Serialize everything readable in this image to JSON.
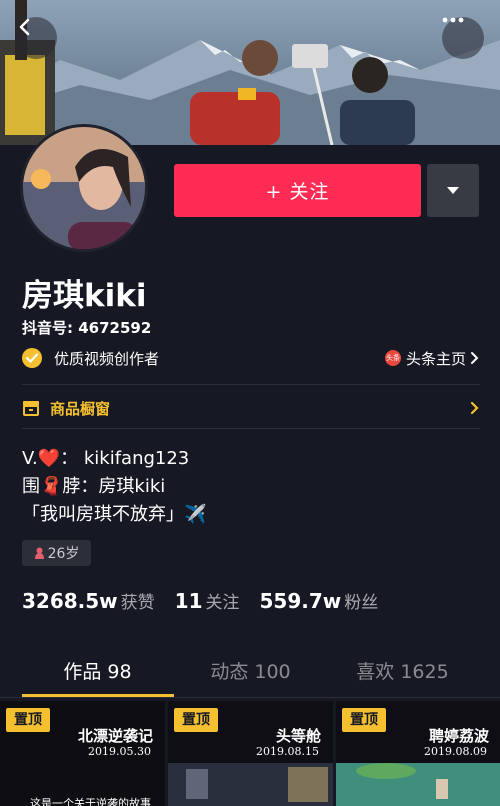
{
  "header": {
    "back_icon": "chevron-left-icon",
    "more_icon": "more-horizontal-icon"
  },
  "profile": {
    "follow_label": "+ 关注",
    "nickname": "房琪kiki",
    "douyin_id": "抖音号: 4672592",
    "badge_text": "优质视频创作者",
    "toutiao_icon_text": "头条",
    "toutiao_label": "头条主页",
    "shop_label": "商品橱窗",
    "bio": [
      "V.❤️： kikifang123",
      "围🧣脖：房琪kiki",
      "「我叫房琪不放弃」✈️"
    ],
    "age": "26岁"
  },
  "stats": [
    {
      "value": "3268.5w",
      "label": "获赞"
    },
    {
      "value": "11",
      "label": "关注"
    },
    {
      "value": "559.7w",
      "label": "粉丝"
    }
  ],
  "tabs": [
    {
      "label": "作品 98",
      "active": true
    },
    {
      "label": "动态 100",
      "active": false
    },
    {
      "label": "喜欢 1625",
      "active": false
    }
  ],
  "videos": [
    {
      "pin": "置顶",
      "title": "北漂逆袭记",
      "date": "2019.05.30",
      "caption": "这是一个关于逆袭的故事"
    },
    {
      "pin": "置顶",
      "title": "头等舱",
      "date": "2019.08.15",
      "caption": ""
    },
    {
      "pin": "置顶",
      "title": "聘婷荔波",
      "date": "2019.08.09",
      "caption": ""
    }
  ],
  "colors": {
    "accent_red": "#fe2c55",
    "accent_yellow": "#f4c02f",
    "background": "#161823"
  }
}
